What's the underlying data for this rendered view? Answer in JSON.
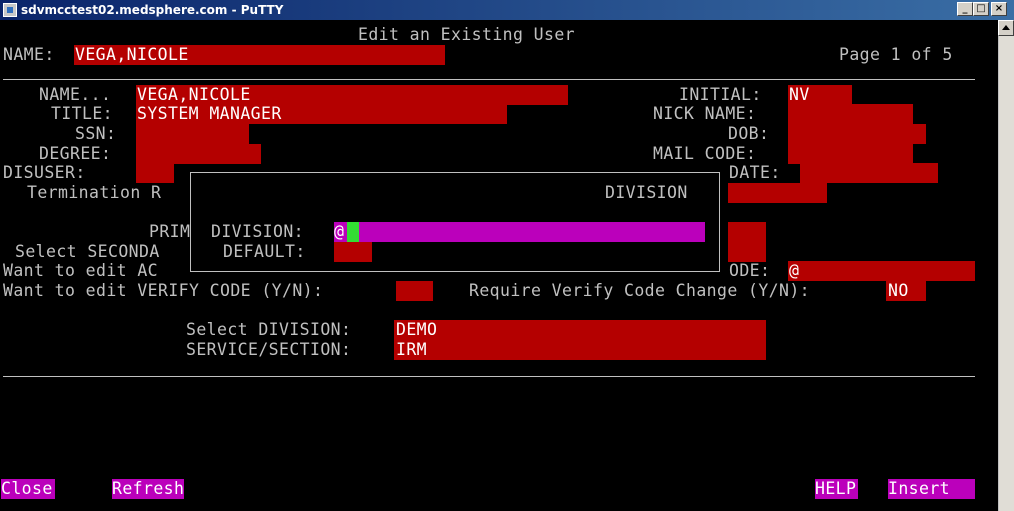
{
  "window": {
    "title": "sdvmcctest02.medsphere.com - PuTTY",
    "minimize": "_",
    "maximize": "□",
    "close": "×"
  },
  "header": {
    "screen_title": "Edit an Existing User",
    "name_label": "NAME:",
    "name_value": "VEGA,NICOLE",
    "page_indicator": "Page 1 of 5"
  },
  "form": {
    "name_label": "NAME...",
    "name_value": "VEGA,NICOLE",
    "initial_label": "INITIAL:",
    "initial_value": "NV",
    "title_label": "TITLE:",
    "title_value": "SYSTEM MANAGER",
    "nickname_label": "NICK NAME:",
    "ssn_label": "SSN:",
    "dob_label": "DOB:",
    "degree_label": "DEGREE:",
    "mailcode_label": "MAIL CODE:",
    "disuser_label": "DISUSER:",
    "date_fragment": "DATE:",
    "termination_fragment": "Termination R",
    "prim_fragment": "PRIM",
    "select_secondary_fragment": "Select SECONDA",
    "want_edit_ac_fragment": "Want to edit AC",
    "code_fragment": "ODE:",
    "code_value": "@",
    "verify_label": "Want to edit VERIFY CODE (Y/N):",
    "require_verify_label": "Require Verify Code Change (Y/N):",
    "require_verify_value": "NO",
    "select_division_label": "Select DIVISION:",
    "select_division_value": "DEMO",
    "service_label": "SERVICE/SECTION:",
    "service_value": "IRM"
  },
  "popup": {
    "title": "DIVISION",
    "division_label": "DIVISION:",
    "division_value": "@",
    "default_label": "DEFAULT:"
  },
  "footer": {
    "close": "Close",
    "refresh": "Refresh",
    "help": "HELP",
    "insert": "Insert"
  },
  "colors": {
    "field_bg": "#b40000",
    "highlight_bg": "#bb00bb",
    "cursor": "#33dd33",
    "text": "#c0c0c0"
  }
}
